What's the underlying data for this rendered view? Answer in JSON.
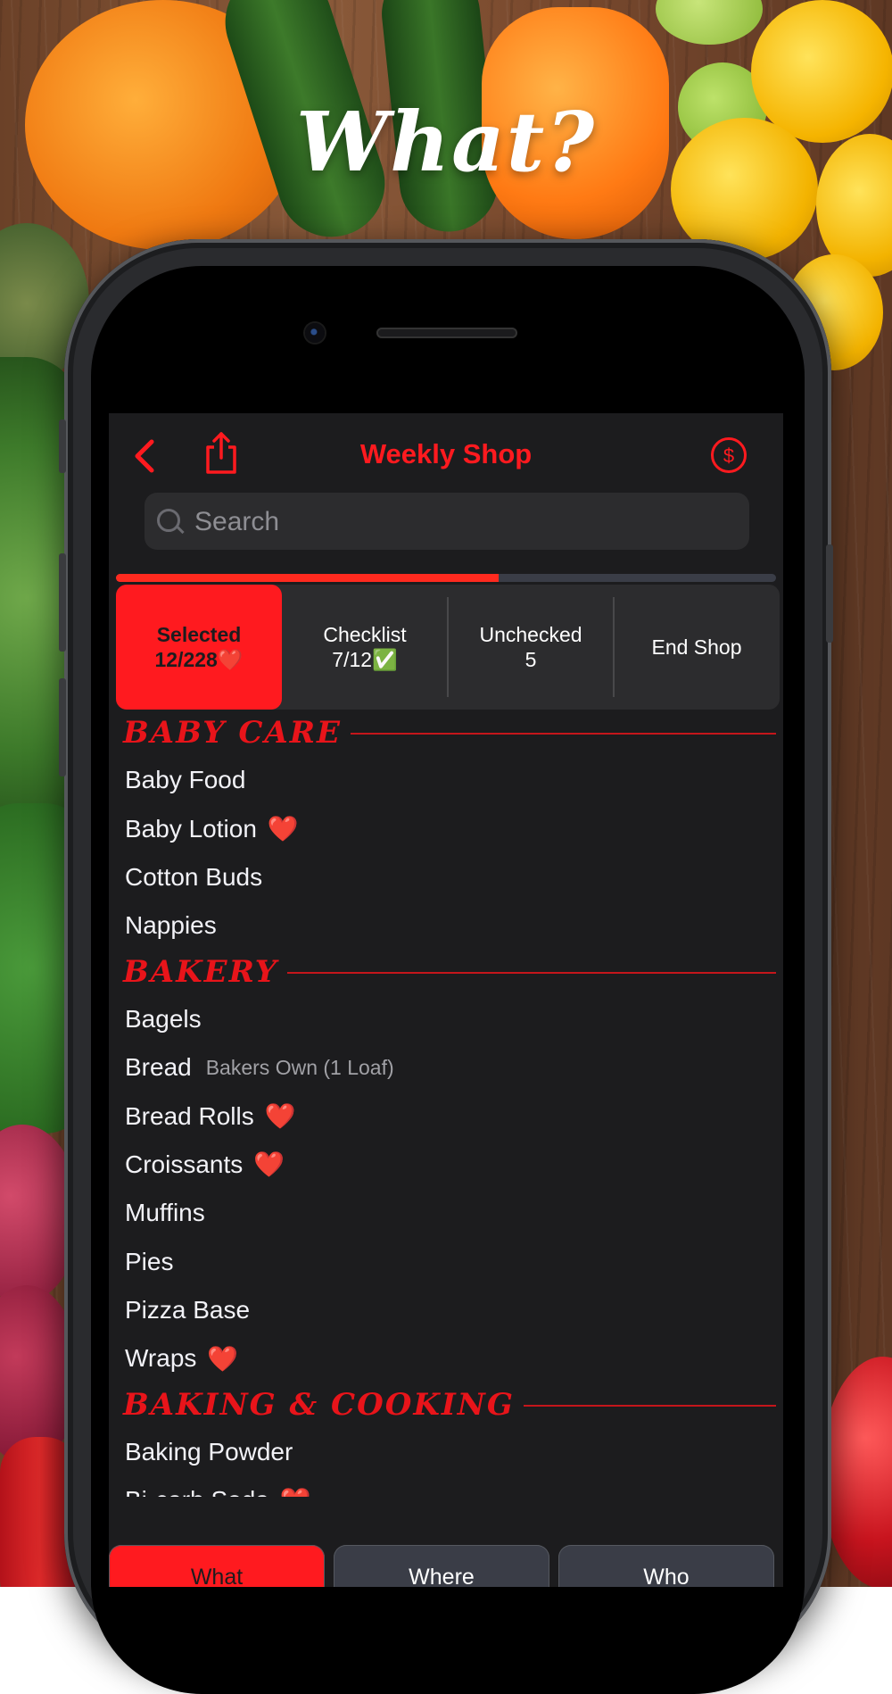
{
  "headline": "What?",
  "nav": {
    "title": "Weekly Shop"
  },
  "search": {
    "placeholder": "Search"
  },
  "progress": {
    "fraction": 0.58
  },
  "segments": [
    {
      "line1": "Selected",
      "line2": "12/228❤️",
      "active": true
    },
    {
      "line1": "Checklist",
      "line2": "7/12✅",
      "active": false
    },
    {
      "line1": "Unchecked",
      "line2": "5",
      "active": false
    },
    {
      "line1": "End Shop",
      "line2": "",
      "active": false
    }
  ],
  "sections": [
    {
      "title": "BABY CARE",
      "items": [
        {
          "name": "Baby Food",
          "note": "",
          "fav": false
        },
        {
          "name": "Baby Lotion",
          "note": "",
          "fav": true
        },
        {
          "name": "Cotton Buds",
          "note": "",
          "fav": false
        },
        {
          "name": "Nappies",
          "note": "",
          "fav": false
        }
      ]
    },
    {
      "title": "BAKERY",
      "items": [
        {
          "name": "Bagels",
          "note": "",
          "fav": false
        },
        {
          "name": "Bread",
          "note": "Bakers Own (1 Loaf)",
          "fav": false
        },
        {
          "name": "Bread Rolls",
          "note": "",
          "fav": true
        },
        {
          "name": "Croissants",
          "note": "",
          "fav": true
        },
        {
          "name": "Muffins",
          "note": "",
          "fav": false
        },
        {
          "name": "Pies",
          "note": "",
          "fav": false
        },
        {
          "name": "Pizza Base",
          "note": "",
          "fav": false
        },
        {
          "name": "Wraps",
          "note": "",
          "fav": true
        }
      ]
    },
    {
      "title": "BAKING & COOKING",
      "items": [
        {
          "name": "Baking Powder",
          "note": "",
          "fav": false
        },
        {
          "name": "Bi-carb Soda",
          "note": "",
          "fav": true
        }
      ]
    }
  ],
  "tabs": [
    {
      "label": "What",
      "active": true
    },
    {
      "label": "Where",
      "active": false
    },
    {
      "label": "Who",
      "active": false
    }
  ],
  "colors": {
    "accent": "#ff1a1f",
    "screen_bg": "#1c1c1e",
    "heart": "#ff3b30"
  },
  "icons": {
    "back": "chevron-left-icon",
    "share": "share-icon",
    "price": "dollar-circle-icon",
    "search": "search-icon"
  }
}
